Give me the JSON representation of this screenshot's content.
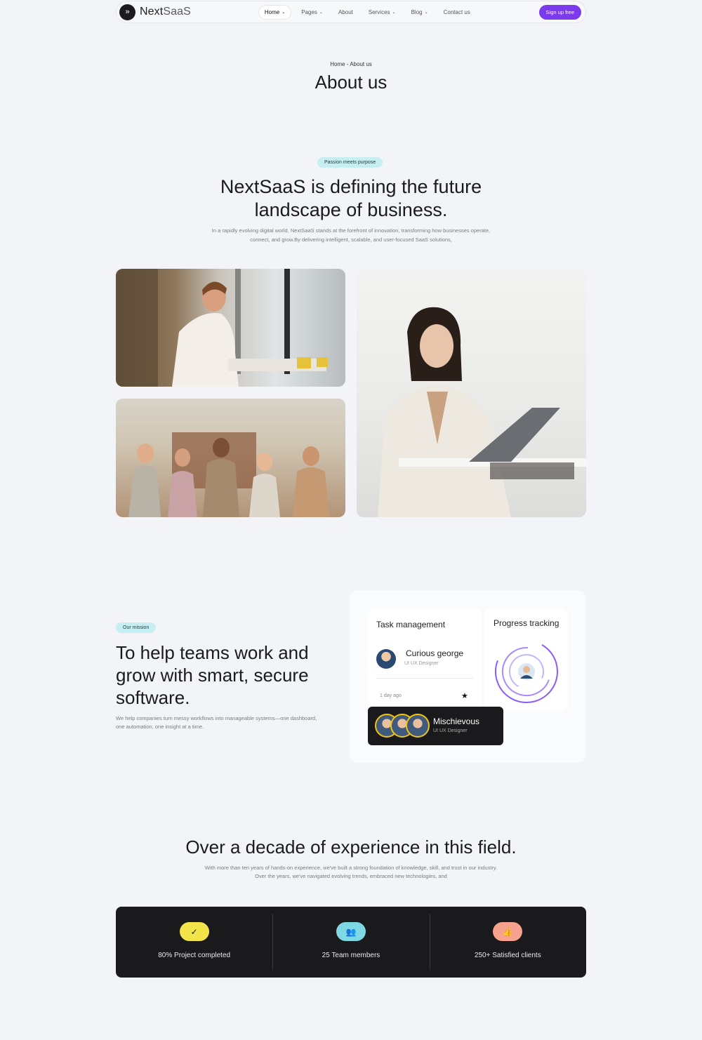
{
  "nav": {
    "logo_mark": "»",
    "brand_first": "Next",
    "brand_second": "SaaS",
    "items": [
      {
        "label": "Home",
        "dropdown": true,
        "active": true
      },
      {
        "label": "Pages",
        "dropdown": true
      },
      {
        "label": "About",
        "dropdown": false
      },
      {
        "label": "Services",
        "dropdown": true
      },
      {
        "label": "Blog",
        "dropdown": true
      },
      {
        "label": "Contact us",
        "dropdown": false
      }
    ],
    "cta": "Sign up free"
  },
  "hero": {
    "breadcrumb": "Home - About us",
    "title": "About us"
  },
  "intro": {
    "pill": "Passion meets purpose",
    "heading": "NextSaaS is defining the future landscape of business.",
    "body": "In a rapidly evolving digital world, NextSaaS stands at the forefront of innovation, transforming how businesses operate, connect, and grow.By delivering intelligent, scalable, and user-focused SaaS solutions,"
  },
  "mission": {
    "pill": "Our mission",
    "heading": "To help teams work and grow with smart, secure software.",
    "body": "We help companies turn messy workflows into manageable systems—one dashboard, one automation, one insight at a time.",
    "task_card": {
      "title": "Task management",
      "person_name": "Curious george",
      "person_role": "UI UX Designer",
      "time": "1 day ago",
      "star": "★"
    },
    "progress_card": {
      "title": "Progress tracking"
    },
    "team_card": {
      "name": "Mischievous",
      "role": "UI UX Designer"
    }
  },
  "experience": {
    "heading": "Over a decade of experience in this field.",
    "body": "With more than ten years of hands-on experience, we've built a strong foundation of knowledge, skill, and trust in our industry. Over the years, we've navigated evolving trends, embraced new technologies, and",
    "stats": [
      {
        "icon": "check-circle-icon",
        "glyph": "✓",
        "color": "#f2e54a",
        "label": "80% Project completed"
      },
      {
        "icon": "users-icon",
        "glyph": "👥",
        "color": "#7fd9e3",
        "label": "25 Team members"
      },
      {
        "icon": "thumbs-up-icon",
        "glyph": "👍",
        "color": "#f6a28f",
        "label": "250+ Satisfied clients"
      }
    ]
  },
  "colors": {
    "accent": "#7c3aed",
    "background": "#f3f4f8",
    "dark_panel": "#1a1a1c",
    "pill_bg": "#c7eff3"
  }
}
